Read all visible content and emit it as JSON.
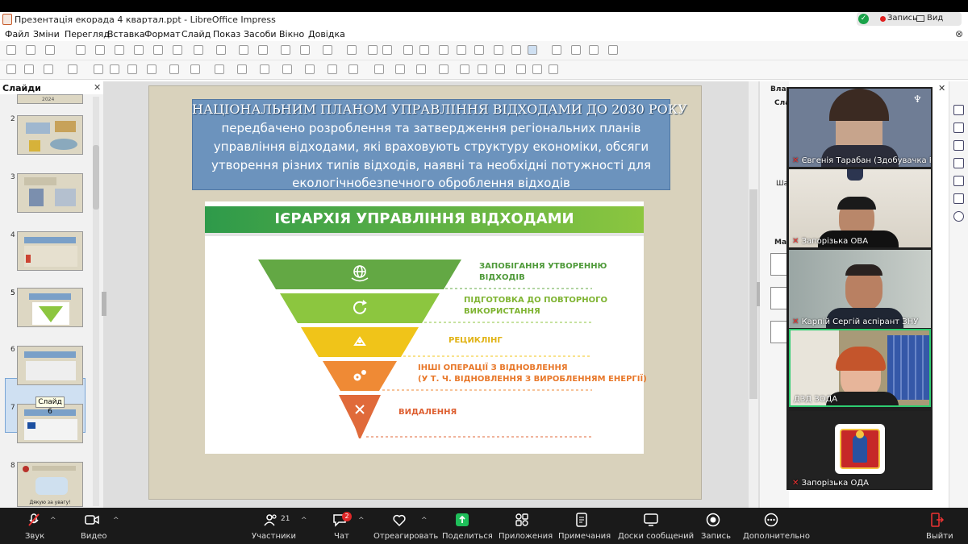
{
  "window": {
    "title": "Презентація екорада 4 квартал.ppt - LibreOffice Impress"
  },
  "recording": {
    "record_label": "Запись",
    "view_label": "Вид"
  },
  "menu": [
    "Файл",
    "Зміни",
    "Перегляд",
    "Вставка",
    "Формат",
    "Слайд",
    "Показ",
    "Засоби",
    "Вікно",
    "Довідка"
  ],
  "slides_panel": {
    "title": "Слайди",
    "numbers": [
      "2",
      "3",
      "4",
      "5",
      "6",
      "7",
      "8"
    ],
    "tooltip": "Слайд 6",
    "last_thumb_text": "Дякую за увагу!",
    "first_thumb_text": "2024"
  },
  "slide": {
    "heading": "НАЦІОНАЛЬНИМ ПЛАНОМ УПРАВЛІННЯ ВІДХОДАМИ  ДО 2030 РОКУ",
    "body_lines": [
      "передбачено розроблення та затвердження регіональних планів",
      "управління відходами, які враховують структуру економіки, обсяги",
      "утворення різних типів відходів, наявні та необхідні  потужності для",
      "екологічнобезпечного оброблення відходів"
    ],
    "infographic": {
      "title": "ІЄРАРХІЯ УПРАВЛІННЯ ВІДХОДАМИ",
      "levels": [
        {
          "label": [
            "ЗАПОБІГАННЯ УТВОРЕННЮ",
            "ВІДХОДІВ"
          ],
          "color": "#63a844",
          "icon": "globe-hand-icon"
        },
        {
          "label": [
            "ПІДГОТОВКА ДО ПОВТОРНОГО",
            "ВИКОРИСТАННЯ"
          ],
          "color": "#8cc63f",
          "icon": "refresh-icon"
        },
        {
          "label": [
            "РЕЦИКЛІНГ"
          ],
          "color": "#f0c419",
          "icon": "recycle-icon"
        },
        {
          "label": [
            "ІНШІ ОПЕРАЦІЇ З ВІДНОВЛЕННЯ",
            "(У Т. Ч. ВІДНОВЛЕННЯ З ВИРОБЛЕННЯМ ЕНЕРГІЇ)"
          ],
          "color": "#ef8a35",
          "icon": "gears-icon"
        },
        {
          "label": [
            "ВИДАЛЕННЯ"
          ],
          "color": "#e06a3a",
          "icon": "cross-icon"
        }
      ]
    }
  },
  "right_panel": {
    "title": "Власт",
    "section1": "Сла",
    "section2": "Ша",
    "section3": "Мак"
  },
  "participants": [
    {
      "name": "Євгенія Тарабан (Здобувачка Ph...",
      "bg": "#6f7d95"
    },
    {
      "name": "Запорізька ОВА",
      "bg": "#4e4638"
    },
    {
      "name": "Карпій Сергій аспірант ЗНУ",
      "bg": "#7c8a88"
    },
    {
      "name": "ДЗД ЗОДА",
      "bg": "#a89a78"
    },
    {
      "name": "Запорізька ОДА",
      "bg": "#222222"
    }
  ],
  "zoom_toolbar": {
    "audio": "Звук",
    "video": "Видео",
    "participants": "Участники",
    "participants_count": "21",
    "chat": "Чат",
    "chat_badge": "2",
    "react": "Отреагировать",
    "share": "Поделиться",
    "apps": "Приложения",
    "notes": "Примечания",
    "whiteboards": "Доски сообщений",
    "record": "Запись",
    "more": "Дополнительно",
    "leave": "Выйти"
  }
}
